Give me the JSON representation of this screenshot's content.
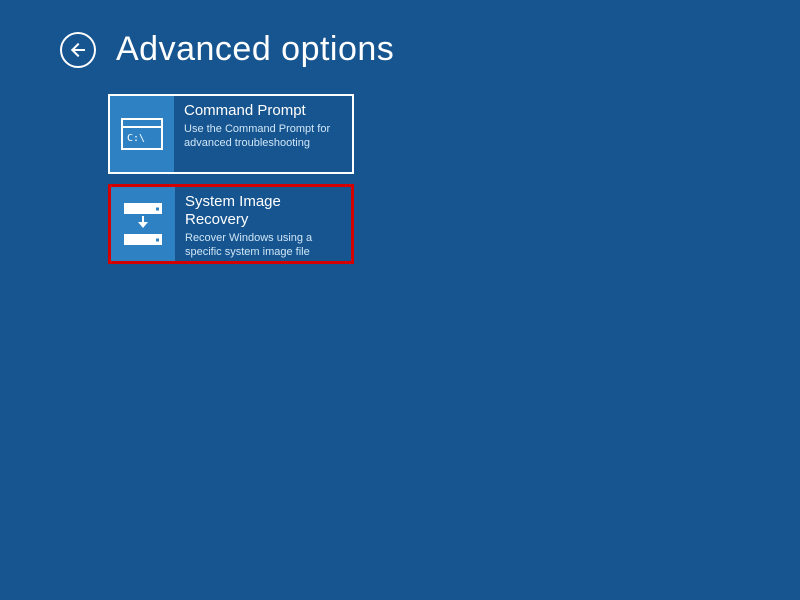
{
  "header": {
    "title": "Advanced options"
  },
  "tiles": [
    {
      "title": "Command Prompt",
      "description": "Use the Command Prompt for advanced troubleshooting",
      "icon": "command-prompt",
      "selected": true,
      "highlighted": false
    },
    {
      "title": "System Image Recovery",
      "description": "Recover Windows using a specific system image file",
      "icon": "system-image-recovery",
      "selected": false,
      "highlighted": true
    }
  ],
  "colors": {
    "background": "#175590",
    "tile_icon_bg": "#2e82c4",
    "highlight_border": "#d40000"
  }
}
